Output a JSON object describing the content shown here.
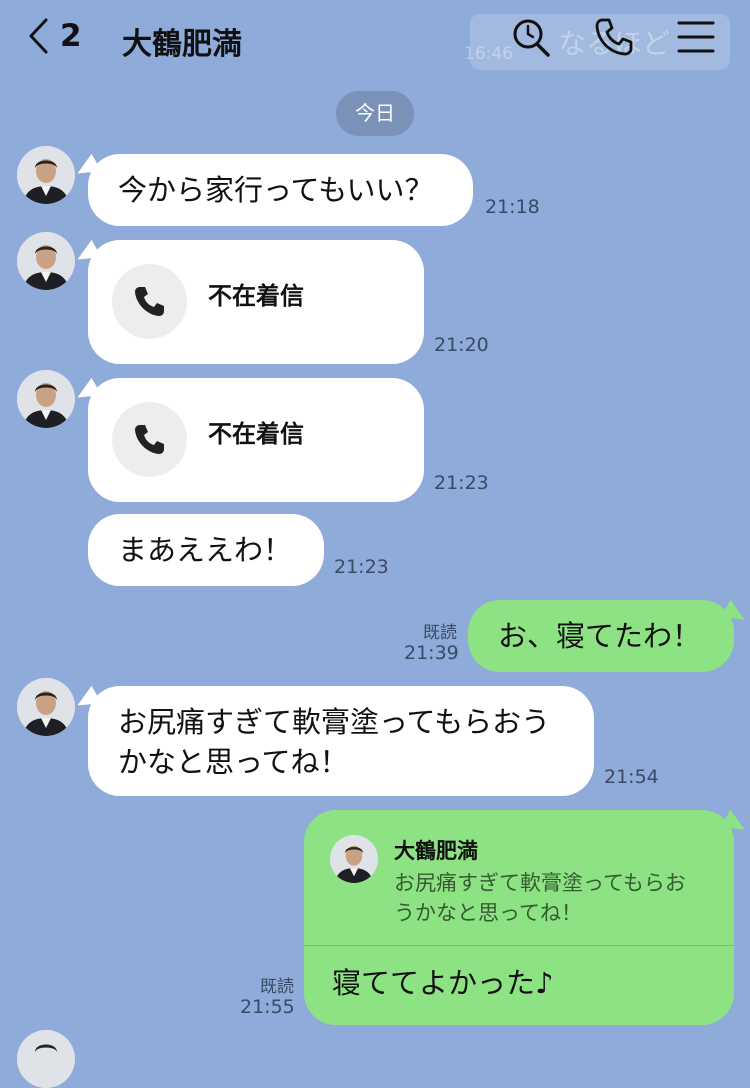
{
  "header": {
    "unread_count": "2",
    "title": "大鶴肥満",
    "ghost_time": "16:46",
    "ghost_text": "なるほど"
  },
  "date_label": "今日",
  "messages": [
    {
      "text": "今から家行ってもいい？",
      "time": "21:18"
    },
    {
      "call_label": "不在着信",
      "time": "21:20"
    },
    {
      "call_label": "不在着信",
      "time": "21:23"
    },
    {
      "text": "まあええわ！",
      "time": "21:23"
    },
    {
      "text": "お、寝てたわ！",
      "read": "既読",
      "time": "21:39"
    },
    {
      "text_line1": "お尻痛すぎて軟膏塗ってもらおう",
      "text_line2": "かなと思ってね！",
      "time": "21:54"
    },
    {
      "quote_name": "大鶴肥満",
      "quote_line1": "お尻痛すぎて軟膏塗ってもらお",
      "quote_line2": "うかなと思ってね！",
      "text": "寝ててよかった♪",
      "read": "既読",
      "time": "21:55"
    }
  ]
}
